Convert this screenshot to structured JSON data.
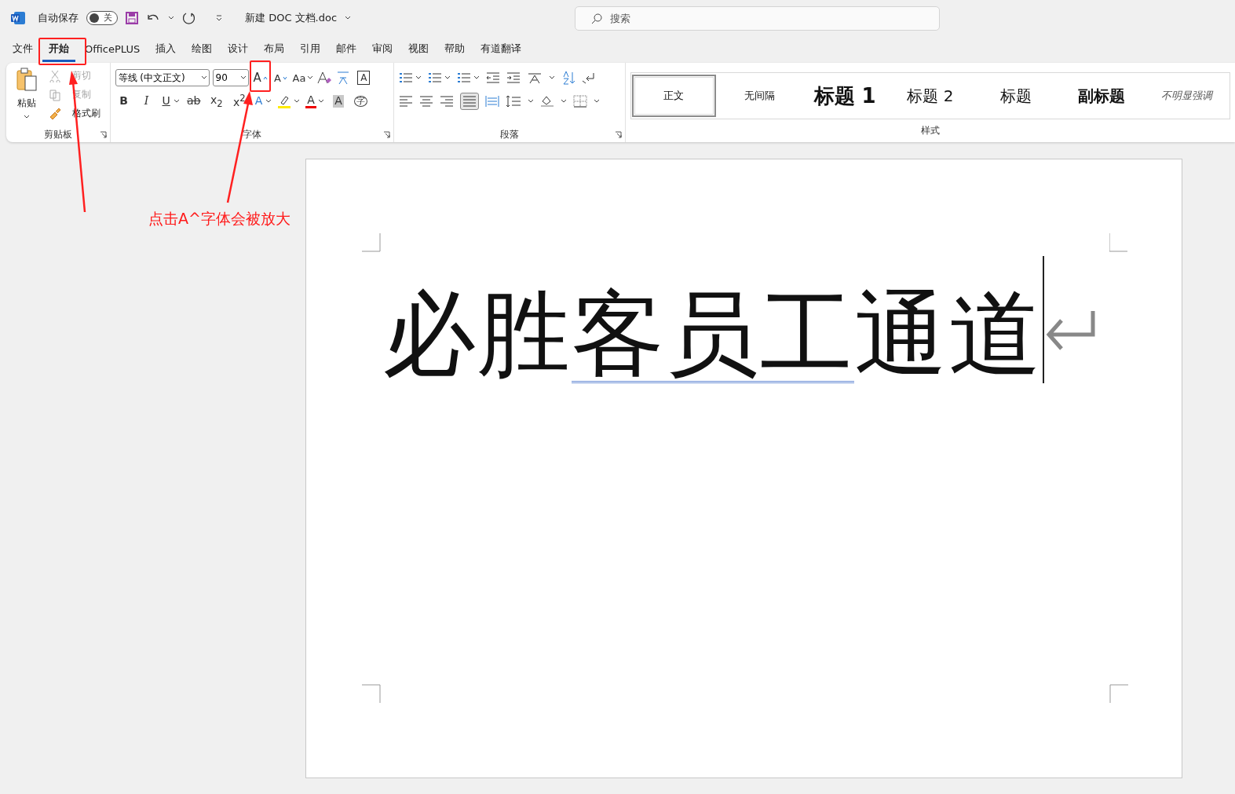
{
  "title_bar": {
    "autosave_label": "自动保存",
    "autosave": {
      "on": false,
      "label": "关"
    },
    "doc_title": "新建 DOC 文档.doc",
    "search": {
      "placeholder": "搜索"
    }
  },
  "menu_tabs": [
    {
      "label": "文件",
      "selected": false
    },
    {
      "label": "开始",
      "selected": true
    },
    {
      "label": "OfficePLUS",
      "selected": false
    },
    {
      "label": "插入",
      "selected": false
    },
    {
      "label": "绘图",
      "selected": false
    },
    {
      "label": "设计",
      "selected": false
    },
    {
      "label": "布局",
      "selected": false
    },
    {
      "label": "引用",
      "selected": false
    },
    {
      "label": "邮件",
      "selected": false
    },
    {
      "label": "审阅",
      "selected": false
    },
    {
      "label": "视图",
      "selected": false
    },
    {
      "label": "帮助",
      "selected": false
    },
    {
      "label": "有道翻译",
      "selected": false
    }
  ],
  "clipboard": {
    "title": "剪贴板",
    "paste": "粘贴",
    "items": [
      {
        "label": "剪切",
        "disabled": true
      },
      {
        "label": "复制",
        "disabled": true
      },
      {
        "label": "格式刷",
        "disabled": false
      }
    ]
  },
  "font": {
    "title": "字体",
    "font_name": "等线 (中文正文)",
    "font_size": "90",
    "grow": "A",
    "shrink": "A",
    "change_case": "Aa",
    "boxed": "A",
    "row2": [
      {
        "label": "B",
        "kind": "bold"
      },
      {
        "label": "I",
        "kind": "italic"
      },
      {
        "label": "U",
        "kind": "underline"
      },
      {
        "label": "ab",
        "kind": "strike"
      },
      {
        "label": "x$_{2}$",
        "kind": "plain"
      },
      {
        "label": "x$^{2}$",
        "kind": "plain"
      },
      {
        "label": "A",
        "kind": "effect"
      },
      {
        "label": "A",
        "kind": "color"
      },
      {
        "label": "A",
        "kind": "shade"
      },
      {
        "label": "字",
        "kind": "enclose"
      }
    ]
  },
  "paragraph": {
    "title": "段落"
  },
  "styles": {
    "title": "样式",
    "items": [
      {
        "label": "正文",
        "kind": "normal",
        "selected": true
      },
      {
        "label": "无间隔",
        "kind": "normal",
        "selected": false
      },
      {
        "label": "标题 1",
        "kind": "heading1",
        "selected": false
      },
      {
        "label": "标题 2",
        "kind": "heading2",
        "selected": false
      },
      {
        "label": "标题",
        "kind": "title",
        "selected": false
      },
      {
        "label": "副标题",
        "kind": "subtitle",
        "selected": false
      },
      {
        "label": "不明显强调",
        "kind": "emphasis",
        "selected": false
      }
    ]
  },
  "document": {
    "segments": [
      {
        "text": "必胜",
        "flagged": false
      },
      {
        "text": "客员工",
        "flagged": true
      },
      {
        "text": "通道",
        "flagged": false
      }
    ]
  },
  "annotation": {
    "caption": "点击A^字体会被放大"
  }
}
